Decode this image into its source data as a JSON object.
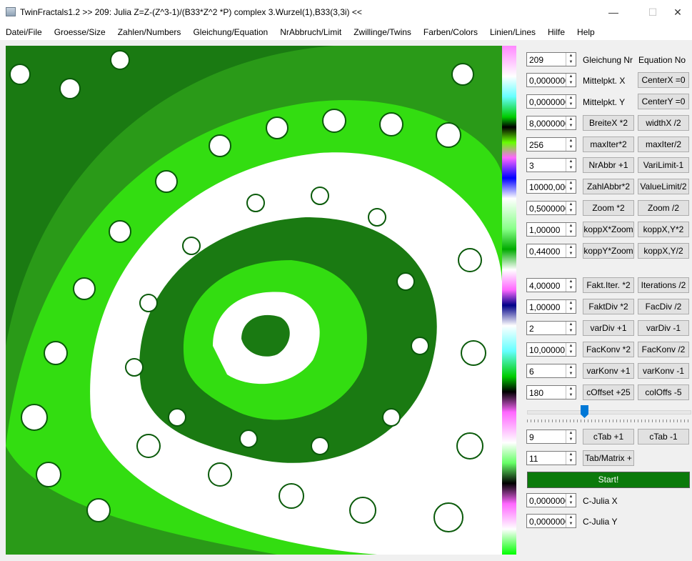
{
  "window": {
    "title": "TwinFractals1.2 >> 209: Julia Z=Z-(Z^3-1)/(B33*Z^2 *P) complex 3.Wurzel(1),B33(3,3i) <<",
    "minimize": "—",
    "maximize": "☐",
    "close": "✕"
  },
  "menu": [
    "Datei/File",
    "Groesse/Size",
    "Zahlen/Numbers",
    "Gleichung/Equation",
    "NrAbbruch/Limit",
    "Zwillinge/Twins",
    "Farben/Colors",
    "Linien/Lines",
    "Hilfe",
    "Help"
  ],
  "controls": {
    "eq_value": "209",
    "eq_label_de": "Gleichung Nr",
    "eq_label_en": "Equation No",
    "cx_value": "0,0000000",
    "cx_label": "Mittelpkt. X",
    "cx_btn": "CenterX =0",
    "cy_value": "0,0000000",
    "cy_label": "Mittelpkt. Y",
    "cy_btn": "CenterY =0",
    "width_value": "8,0000000",
    "width_btn1": "BreiteX *2",
    "width_btn2": "widthX /2",
    "maxiter_value": "256",
    "maxiter_btn1": "maxIter*2",
    "maxiter_btn2": "maxIter/2",
    "nrabbr_value": "3",
    "nrabbr_btn1": "NrAbbr +1",
    "nrabbr_btn2": "VariLimit-1",
    "zahlabbr_value": "10000,000",
    "zahlabbr_btn1": "ZahlAbbr*2",
    "zahlabbr_btn2": "ValueLimit/2",
    "zoom_value": "0,5000000",
    "zoom_btn1": "Zoom *2",
    "zoom_btn2": "Zoom /2",
    "koppx_value": "1,00000",
    "koppx_btn1": "koppX*Zoom",
    "koppx_btn2": "koppX,Y*2",
    "koppy_value": "0,44000",
    "koppy_btn1": "koppY*Zoom",
    "koppy_btn2": "koppX,Y/2",
    "faktiter_value": "4,00000",
    "faktiter_btn1": "Fakt.Iter. *2",
    "faktiter_btn2": "Iterations /2",
    "faktdiv_value": "1,00000",
    "faktdiv_btn1": "FaktDiv *2",
    "faktdiv_btn2": "FacDiv /2",
    "vardiv_value": "2",
    "vardiv_btn1": "varDiv +1",
    "vardiv_btn2": "varDiv -1",
    "fackonv_value": "10,00000",
    "fackonv_btn1": "FacKonv *2",
    "fackonv_btn2": "FacKonv /2",
    "varkonv_value": "6",
    "varkonv_btn1": "varKonv +1",
    "varkonv_btn2": "varKonv -1",
    "coffset_value": "180",
    "coffset_btn1": "cOffset +25",
    "coffset_btn2": "colOffs -5",
    "slider_level": 0.35,
    "ctab_value": "9",
    "ctab_btn1": "cTab +1",
    "ctab_btn2": "cTab -1",
    "tabmatrix_value": "11",
    "tabmatrix_btn": "Tab/Matrix +",
    "start": "Start!",
    "cjx_value": "0,0000000",
    "cjx_label": "C-Julia X",
    "cjy_value": "0,0000000",
    "cjy_label": "C-Julia Y"
  },
  "colors": {
    "start_button": "#0b7a0b",
    "fractal_dark": "#1a7a12",
    "fractal_light": "#33dd11",
    "fractal_white": "#ffffff"
  }
}
